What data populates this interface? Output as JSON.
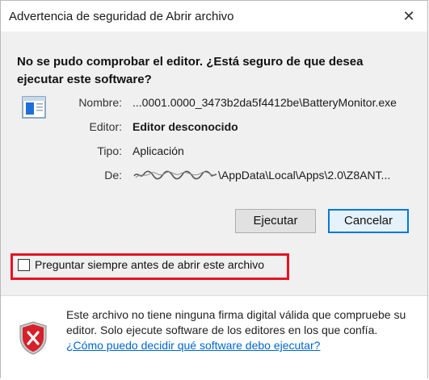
{
  "window": {
    "title": "Advertencia de seguridad de Abrir archivo"
  },
  "heading": "No se pudo comprobar el editor. ¿Está seguro de que desea ejecutar este software?",
  "details": {
    "name_label": "Nombre:",
    "name_value": "...0001.0000_3473b2da5f4412be\\BatteryMonitor.exe",
    "publisher_label": "Editor:",
    "publisher_value": "Editor desconocido",
    "type_label": "Tipo:",
    "type_value": "Aplicación",
    "from_label": "De:",
    "from_value": "\\AppData\\Local\\Apps\\2.0\\Z8ANT..."
  },
  "buttons": {
    "run": "Ejecutar",
    "cancel": "Cancelar"
  },
  "checkbox": {
    "label": "Preguntar siempre antes de abrir este archivo",
    "checked": false
  },
  "footer": {
    "text": "Este archivo no tiene ninguna firma digital válida que compruebe su editor. Solo ejecute software de los editores en los que confía.",
    "link": "¿Cómo puedo decidir qué software debo ejecutar?"
  },
  "colors": {
    "highlight": "#e81123",
    "link": "#0066cc",
    "primary_border": "#0078d7"
  },
  "icons": [
    "close-icon",
    "application-file-icon",
    "security-shield-icon"
  ]
}
